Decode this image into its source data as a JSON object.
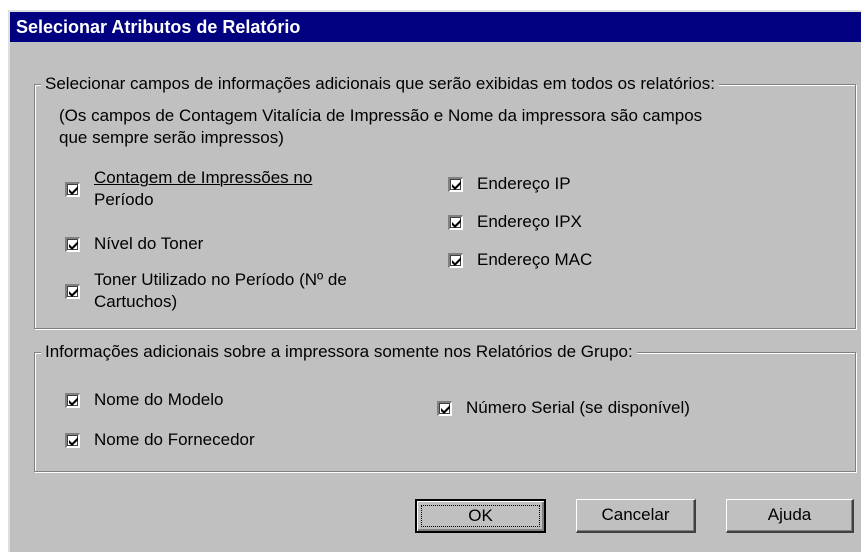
{
  "window": {
    "title": "Selecionar Atributos de Relatório"
  },
  "group1": {
    "legend": "Selecionar campos de informações adicionais que serão exibidas em todos os relatórios:",
    "note_line1": "(Os campos de Contagem Vitalícia de Impressão e  Nome da impressora são campos",
    "note_line2": "que sempre serão impressos)",
    "checkboxes": [
      {
        "line1": "Contagem de Impressões no",
        "line2": "Período",
        "checked": true
      },
      {
        "label": "Nível do Toner",
        "checked": true
      },
      {
        "line1": "Toner Utilizado no Período (Nº de",
        "line2": "Cartuchos)",
        "checked": true
      },
      {
        "label": "Endereço IP",
        "checked": true
      },
      {
        "label": "Endereço IPX",
        "checked": true
      },
      {
        "label": "Endereço MAC",
        "checked": true
      }
    ]
  },
  "group2": {
    "legend": "Informações adicionais sobre a impressora somente nos Relatórios de Grupo:",
    "checkboxes": [
      {
        "label": "Nome do Modelo",
        "checked": true
      },
      {
        "label": "Nome do Fornecedor",
        "checked": true
      },
      {
        "label": "Número Serial (se disponível)",
        "checked": true
      }
    ]
  },
  "buttons": {
    "ok": "OK",
    "cancel": "Cancelar",
    "help": "Ajuda"
  },
  "colors": {
    "titlebar": "#000080",
    "face": "#c0c0c0"
  }
}
